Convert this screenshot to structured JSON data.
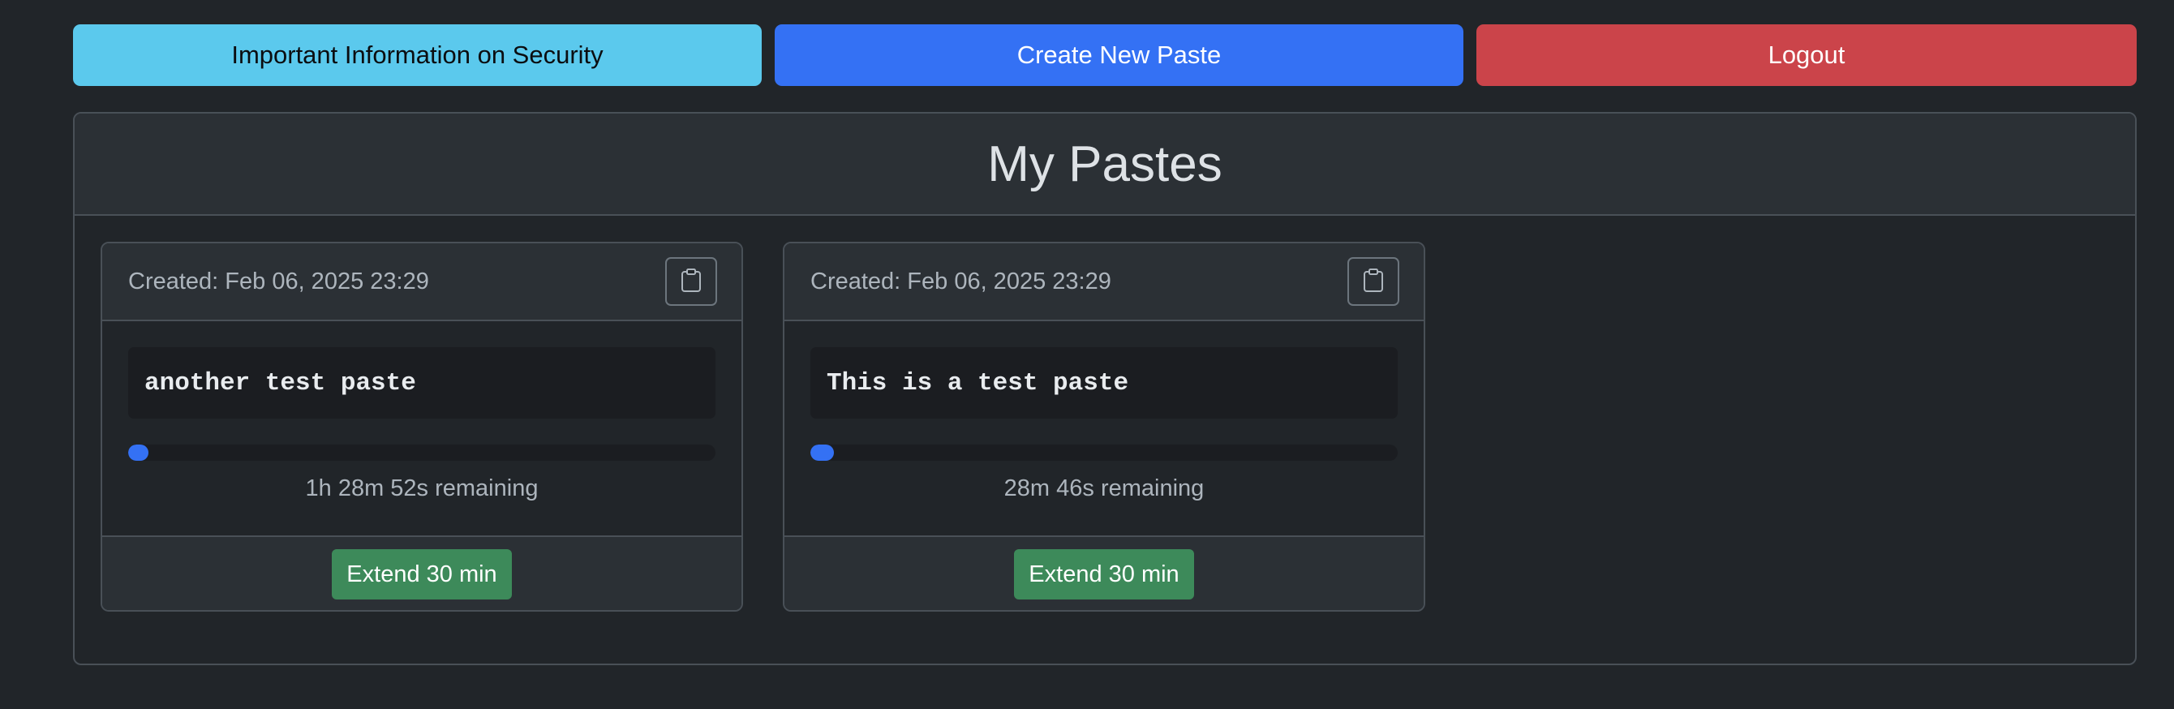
{
  "toolbar": {
    "security_label": "Important Information on Security",
    "create_label": "Create New Paste",
    "logout_label": "Logout"
  },
  "colors": {
    "info": "#5bc9ed",
    "primary": "#3471f4",
    "danger": "#cb444a",
    "success": "#3d8a5a",
    "background": "#212529"
  },
  "main": {
    "title": "My Pastes"
  },
  "pastes": [
    {
      "created": "Created: Feb 06, 2025 23:29",
      "content": "another test paste",
      "progress_fraction": 0.035,
      "remaining": "1h 28m 52s remaining",
      "extend_label": "Extend 30 min",
      "copy_icon": "clipboard-icon"
    },
    {
      "created": "Created: Feb 06, 2025 23:29",
      "content": "This is a test paste",
      "progress_fraction": 0.04,
      "remaining": "28m 46s remaining",
      "extend_label": "Extend 30 min",
      "copy_icon": "clipboard-icon"
    }
  ]
}
